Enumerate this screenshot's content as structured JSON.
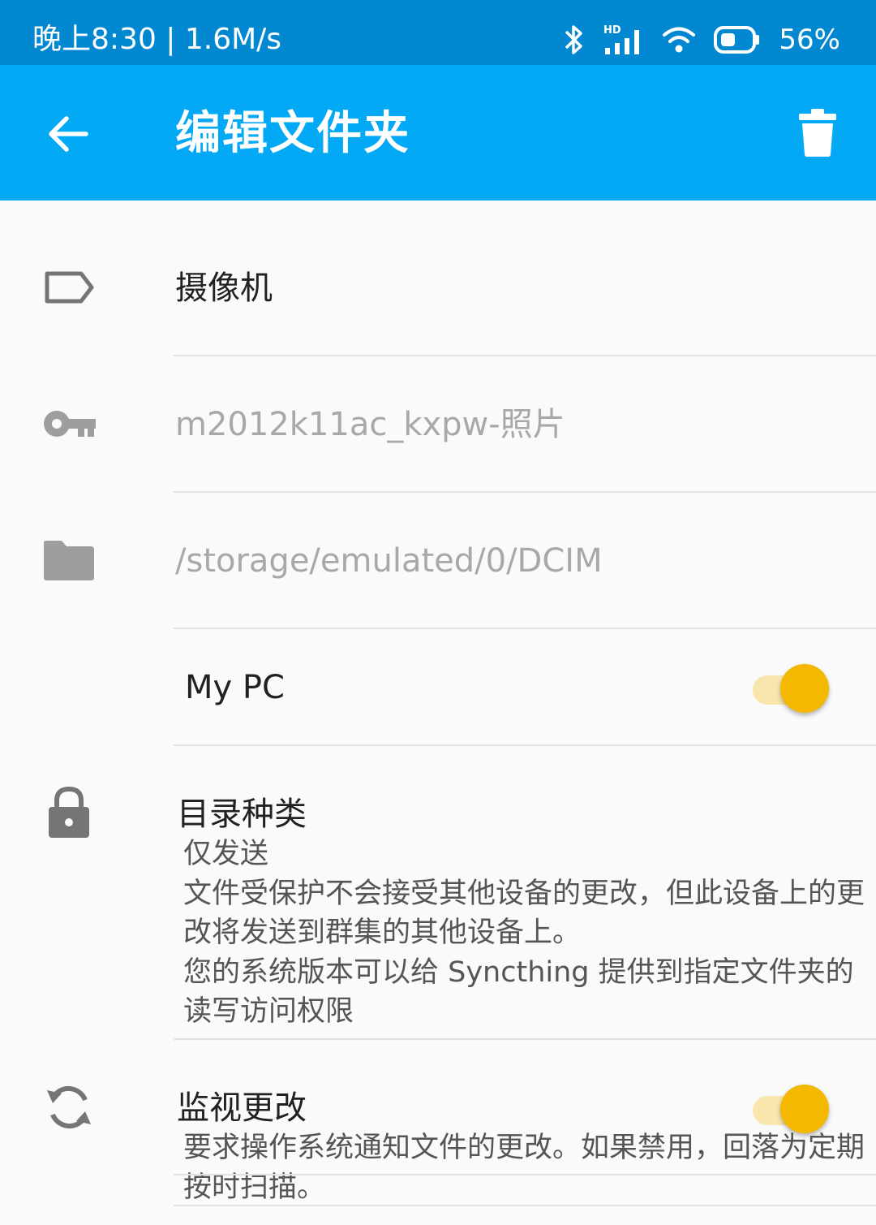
{
  "status_bar": {
    "time_speed": "晚上8:30 | 1.6M/s",
    "battery": "56%",
    "icons": [
      "bluetooth-icon",
      "hd-signal-icon",
      "wifi-icon",
      "battery-icon"
    ]
  },
  "app_bar": {
    "title": "编辑文件夹",
    "back_icon": "arrow-back-icon",
    "delete_icon": "trash-icon",
    "color": "#03a9f4"
  },
  "folder": {
    "label": "摄像机",
    "label_icon": "label-tag-icon",
    "id": "m2012k11ac_kxpw-照片",
    "id_icon": "key-icon",
    "path": "/storage/emulated/0/DCIM",
    "path_icon": "folder-icon"
  },
  "devices": [
    {
      "name": "My PC",
      "shared": true
    }
  ],
  "folder_type": {
    "title": "目录种类",
    "icon": "lock-icon",
    "desc_lines": [
      "仅发送",
      "文件受保护不会接受其他设备的更改，但此设备上的更",
      "改将发送到群集的其他设备上。",
      "您的系统版本可以给 Syncthing 提供到指定文件夹的",
      "读写访问权限"
    ]
  },
  "watch_changes": {
    "title": "监视更改",
    "icon": "sync-icon",
    "enabled": true,
    "desc_lines": [
      "要求操作系统通知文件的更改。如果禁用，回落为定期",
      "按时扫描。"
    ]
  },
  "colors": {
    "status_bar": "#0288d1",
    "accent": "#f5b800"
  }
}
